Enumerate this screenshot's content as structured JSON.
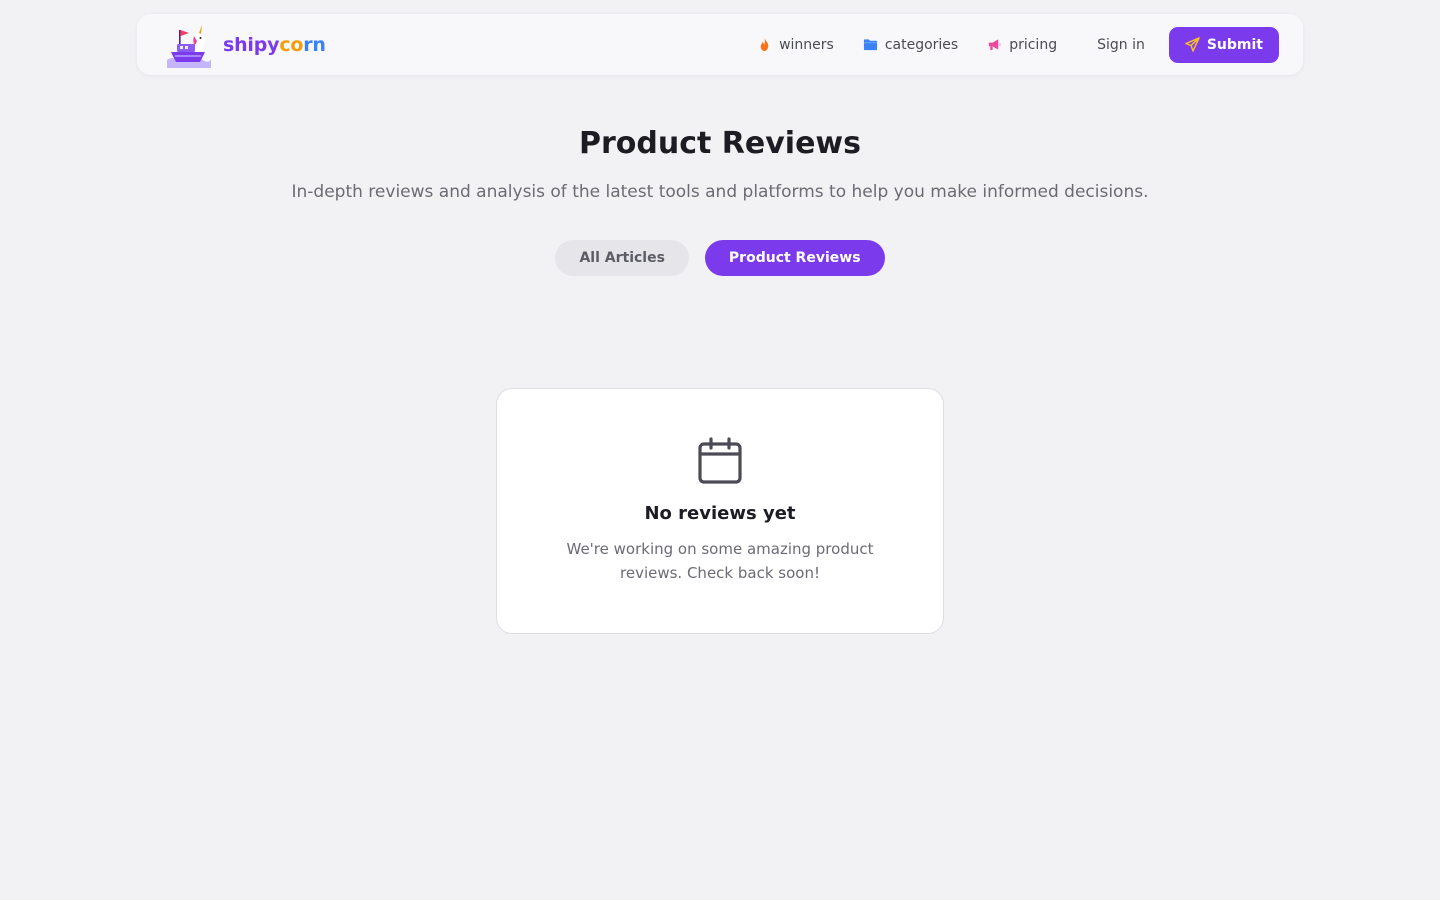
{
  "nav": {
    "brand": {
      "part1": "shipy",
      "part2": "co",
      "part3": "rn"
    },
    "links": [
      {
        "label": "winners",
        "icon": "flame-icon",
        "color": "#f97316"
      },
      {
        "label": "categories",
        "icon": "folder-icon",
        "color": "#3b82f6"
      },
      {
        "label": "pricing",
        "icon": "megaphone-icon",
        "color": "#ec4899"
      }
    ],
    "signin_label": "Sign in",
    "submit_label": "Submit",
    "submit_icon": "send-icon"
  },
  "hero": {
    "title": "Product Reviews",
    "subtitle": "In-depth reviews and analysis of the latest tools and platforms to help you make informed decisions."
  },
  "filters": [
    {
      "label": "All Articles",
      "active": false
    },
    {
      "label": "Product Reviews",
      "active": true
    }
  ],
  "empty_state": {
    "icon": "calendar-icon",
    "title": "No reviews yet",
    "message": "We're working on some amazing product reviews. Check back soon!"
  },
  "colors": {
    "accent": "#7c3aed",
    "background": "#f2f2f5"
  }
}
